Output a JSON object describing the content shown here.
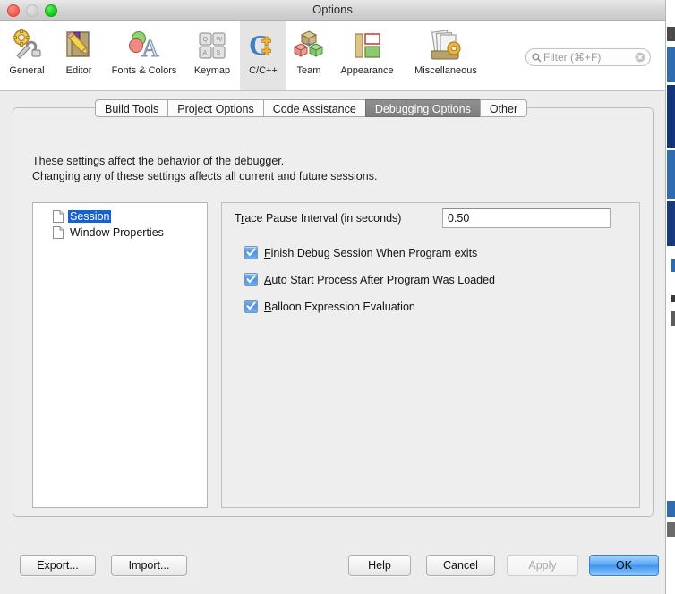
{
  "window": {
    "title": "Options",
    "traffic_lights": [
      "close-button",
      "minimize-button",
      "zoom-button"
    ]
  },
  "toolbar": {
    "items": [
      {
        "label": "General",
        "icon": "gear-wrench-icon",
        "selected": false
      },
      {
        "label": "Editor",
        "icon": "book-pencil-icon",
        "selected": false
      },
      {
        "label": "Fonts & Colors",
        "icon": "font-palette-icon",
        "selected": false
      },
      {
        "label": "Keymap",
        "icon": "keyboard-keys-icon",
        "selected": false
      },
      {
        "label": "C/C++",
        "icon": "c-plus-plus-icon",
        "selected": true
      },
      {
        "label": "Team",
        "icon": "cubes-icon",
        "selected": false
      },
      {
        "label": "Appearance",
        "icon": "layout-panels-icon",
        "selected": false
      },
      {
        "label": "Miscellaneous",
        "icon": "documents-gear-icon",
        "selected": false
      }
    ],
    "search": {
      "placeholder": "Filter (⌘+F)",
      "value": "",
      "icon": "search-icon",
      "clear_icon": "clear-circle-icon"
    }
  },
  "tabs": [
    {
      "label": "Build Tools",
      "active": false
    },
    {
      "label": "Project Options",
      "active": false
    },
    {
      "label": "Code Assistance",
      "active": false
    },
    {
      "label": "Debugging Options",
      "active": true
    },
    {
      "label": "Other",
      "active": false
    }
  ],
  "description": {
    "line1": "These settings affect the behavior of the debugger.",
    "line2": "Changing any of these settings affects all current and future sessions."
  },
  "tree": {
    "items": [
      {
        "label": "Session",
        "icon": "document-icon",
        "selected": true
      },
      {
        "label": "Window Properties",
        "icon": "document-icon",
        "selected": false
      }
    ]
  },
  "settings": {
    "trace_pause": {
      "label_pre": "T",
      "label_mnemonic": "r",
      "label_post": "ace Pause Interval (in seconds)",
      "value": "0.50"
    },
    "checkboxes": [
      {
        "mnemonic": "F",
        "pre": "",
        "post": "inish Debug Session When Program exits",
        "checked": true
      },
      {
        "mnemonic": "A",
        "pre": "",
        "post": "uto Start Process After Program Was Loaded",
        "checked": true
      },
      {
        "mnemonic": "B",
        "pre": "",
        "post": "alloon Expression Evaluation",
        "checked": true
      }
    ]
  },
  "buttons": {
    "export": "Export...",
    "import": "Import...",
    "help": "Help",
    "cancel": "Cancel",
    "apply": "Apply",
    "ok": "OK"
  },
  "colors": {
    "selection_blue": "#1661d1",
    "default_button_blue": "#3f93ef",
    "active_tab_gray": "#7e7e7e",
    "window_bg": "#ececec"
  }
}
